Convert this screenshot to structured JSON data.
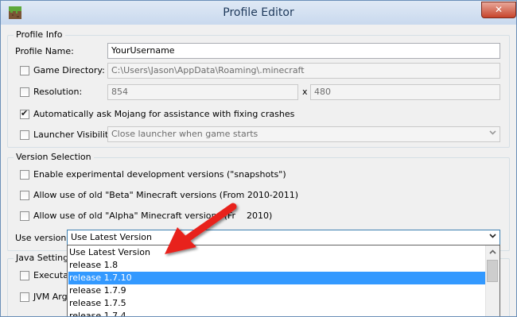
{
  "window": {
    "title": "Profile Editor",
    "close_glyph": "✕"
  },
  "profile_info": {
    "legend": "Profile Info",
    "profile_name_label": "Profile Name:",
    "profile_name_value": "YourUsername",
    "game_directory_label": "Game Directory:",
    "game_directory_value": "C:\\Users\\Jason\\AppData\\Roaming\\.minecraft",
    "resolution_label": "Resolution:",
    "resolution_width": "854",
    "resolution_x": "x",
    "resolution_height": "480",
    "crash_assist_label": "Automatically ask Mojang for assistance with fixing crashes",
    "launcher_visibility_label": "Launcher Visibility:",
    "launcher_visibility_value": "Close launcher when game starts"
  },
  "version_selection": {
    "legend": "Version Selection",
    "snapshots_label": "Enable experimental development versions (\"snapshots\")",
    "beta_label": "Allow use of old \"Beta\" Minecraft versions (From 2010-2011)",
    "alpha_label_start": "Allow use of old \"Alpha\" Minecraft versions (Fr",
    "alpha_label_end": "2010)",
    "use_version_label": "Use version:",
    "use_version_value": "Use Latest Version"
  },
  "java_settings": {
    "legend": "Java Settings",
    "executable_label": "Executab",
    "jvm_label": "JVM Argu"
  },
  "dropdown": {
    "options": [
      "Use Latest Version",
      "release 1.8",
      "release 1.7.10",
      "release 1.7.9",
      "release 1.7.5",
      "release 1.7.4"
    ],
    "highlighted": "release 1.7.10"
  },
  "colors": {
    "highlight": "#3399ff",
    "annotation_arrow": "#e8211c"
  },
  "icons": [
    "minecraft-grass-block-icon",
    "close-icon",
    "dropdown-chevron-icon",
    "scroll-up-icon",
    "red-annotation-arrow-icon"
  ]
}
